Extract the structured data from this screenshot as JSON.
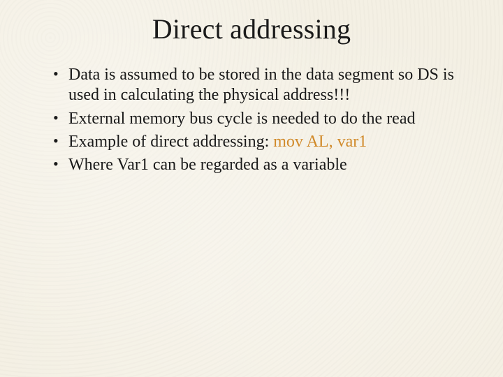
{
  "slide": {
    "title": "Direct addressing",
    "bullets": [
      "Data is assumed to be stored in the data segment so DS is used in calculating the physical address!!!",
      "External memory bus cycle is needed to do the read"
    ],
    "example": {
      "prefix": "Example of direct addressing: ",
      "instruction": "mov AL, var1"
    },
    "bullet4": "Where Var1 can be regarded as a variable"
  }
}
